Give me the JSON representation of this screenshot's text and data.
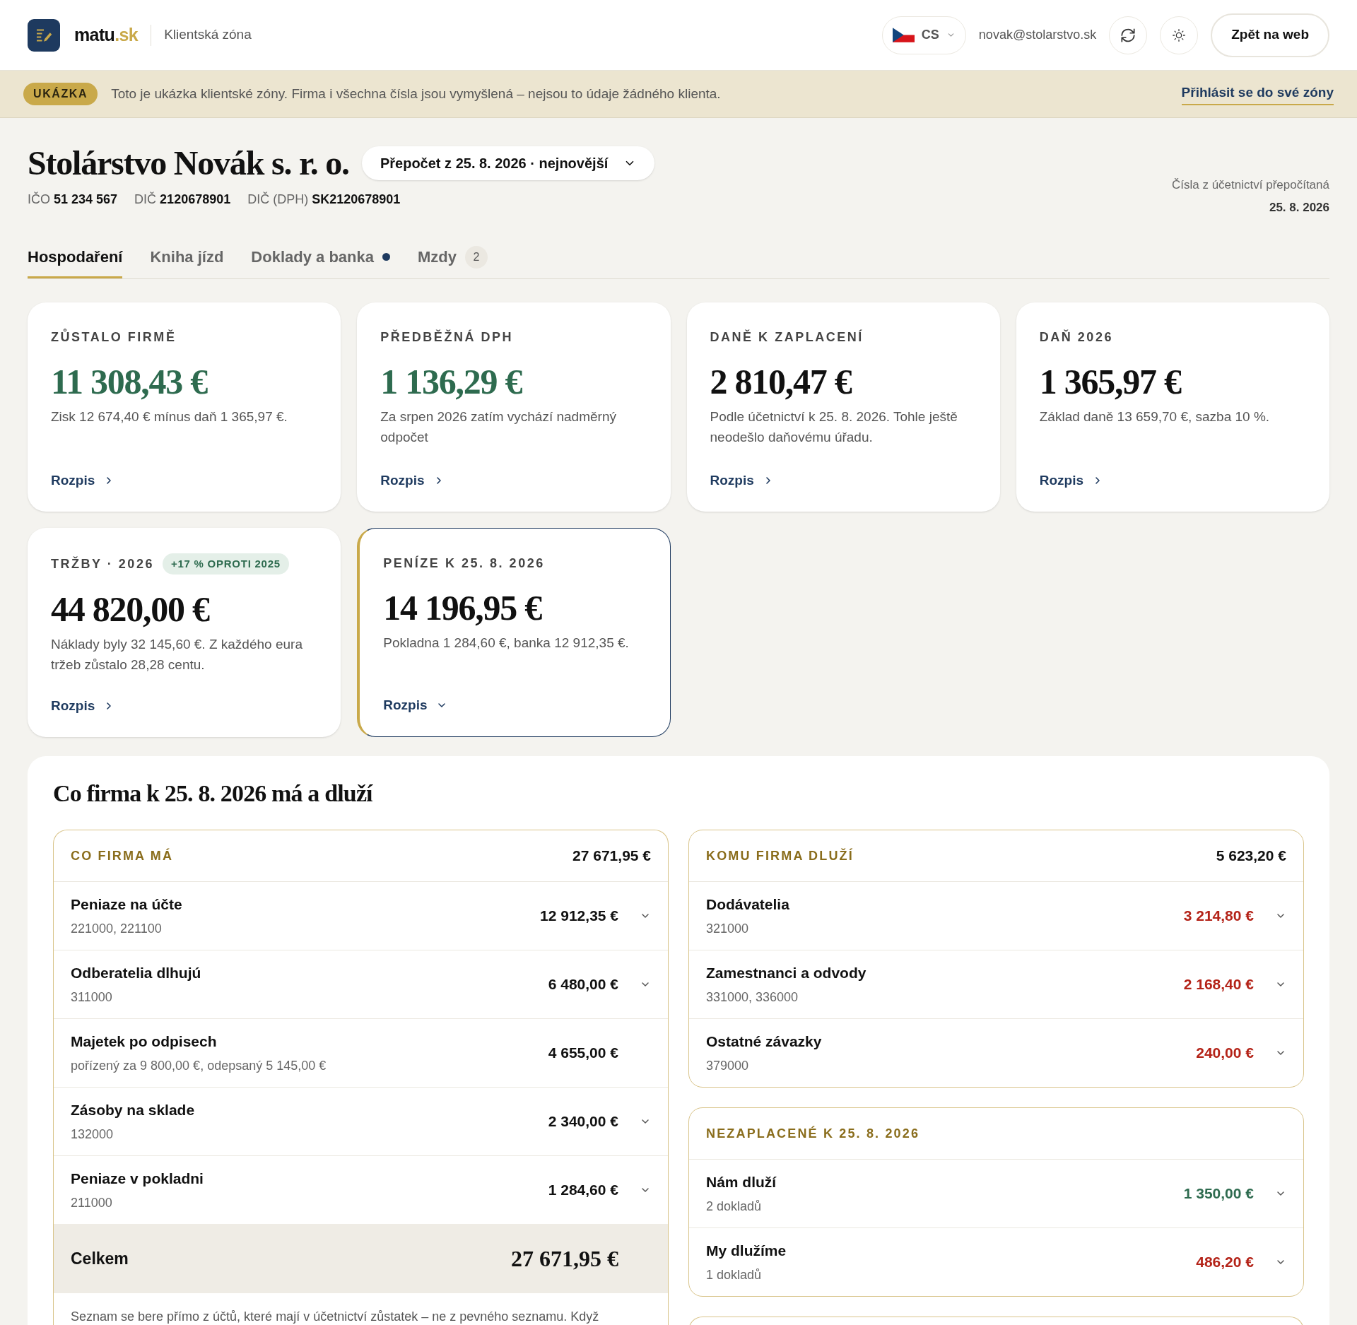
{
  "header": {
    "logo_text": "matu",
    "logo_domain": ".sk",
    "subtitle": "Klientská zóna",
    "language": "CS",
    "email": "novak@stolarstvo.sk",
    "back_button": "Zpět na web"
  },
  "banner": {
    "badge": "UKÁZKA",
    "text": "Toto je ukázka klientské zóny. Firma i všechna čísla jsou vymyšlená – nejsou to údaje žádného klienta.",
    "link": "Přihlásit se do své zóny"
  },
  "company": {
    "name": "Stolárstvo Novák s. r. o.",
    "period_select": "Přepočet z 25. 8. 2026 · nejnovější",
    "ids": [
      {
        "label": "IČO",
        "value": "51 234 567"
      },
      {
        "label": "DIČ",
        "value": "2120678901"
      },
      {
        "label": "DIČ (DPH)",
        "value": "SK2120678901"
      }
    ],
    "recalc_note": "Čísla z účetnictví přepočítaná",
    "recalc_date": "25. 8. 2026"
  },
  "tabs": [
    {
      "label": "Hospodaření",
      "selected": true,
      "dot": false
    },
    {
      "label": "Kniha jízd",
      "selected": false,
      "dot": false
    },
    {
      "label": "Doklady a banka",
      "selected": false,
      "dot": true
    },
    {
      "label": "Mzdy",
      "selected": false,
      "dot": false,
      "count": "2"
    }
  ],
  "cards": [
    {
      "title": "ZŮSTALO FIRMĚ",
      "value": "11 308,43 €",
      "color": "#2e6b4f",
      "note": "Zisk 12 674,40 € mínus daň 1 365,97 €.",
      "link": "Rozpis",
      "expanded": false
    },
    {
      "title": "PŘEDBĚŽNÁ DPH",
      "value": "1 136,29 €",
      "color": "#2e6b4f",
      "note": "Za srpen 2026 zatím vychází nadměrný odpočet",
      "link": "Rozpis",
      "expanded": false
    },
    {
      "title": "DANĚ K ZAPLACENÍ",
      "value": "2 810,47 €",
      "color": "#111111",
      "note": "Podle účetnictví k 25. 8. 2026. Tohle ještě neodešlo daňovému úřadu.",
      "link": "Rozpis",
      "expanded": false
    },
    {
      "title": "DAŇ 2026",
      "value": "1 365,97 €",
      "color": "#111111",
      "note": "Základ daně 13 659,70 €, sazba 10 %.",
      "link": "Rozpis",
      "expanded": false
    },
    {
      "title": "TRŽBY · 2026",
      "badge": "+17 % OPROTI 2025",
      "value": "44 820,00 €",
      "color": "#111111",
      "note": "Náklady byly 32 145,60 €. Z každého eura tržeb zůstalo 28,28 centu.",
      "link": "Rozpis",
      "expanded": false
    },
    {
      "title": "PENÍZE K 25. 8. 2026",
      "value": "14 196,95 €",
      "color": "#111111",
      "note": "Pokladna 1 284,60 €, banka 12 912,35 €.",
      "link": "Rozpis",
      "expanded": true
    }
  ],
  "balance": {
    "title": "Co firma k 25. 8. 2026 má a dluží",
    "assets": {
      "heading": "CO FIRMA MÁ",
      "total": "27 671,95 €",
      "rows": [
        {
          "name": "Peniaze na účte",
          "detail": "221000, 221100",
          "amount": "12 912,35 €",
          "color": "#111111",
          "expandable": true
        },
        {
          "name": "Odberatelia dlhujú",
          "detail": "311000",
          "amount": "6 480,00 €",
          "color": "#111111",
          "expandable": true
        },
        {
          "name": "Majetek po odpisech",
          "detail": "pořízený za 9 800,00 €, odepsaný 5 145,00 €",
          "amount": "4 655,00 €",
          "color": "#111111",
          "expandable": false
        },
        {
          "name": "Zásoby na sklade",
          "detail": "132000",
          "amount": "2 340,00 €",
          "color": "#111111",
          "expandable": true
        },
        {
          "name": "Peniaze v pokladni",
          "detail": "211000",
          "amount": "1 284,60 €",
          "color": "#111111",
          "expandable": true
        }
      ],
      "sum_label": "Celkem",
      "sum_value": "27 671,95 €",
      "footnote": "Seznam se bere přímo z účtů, které mají v účetnictví zůstatek – ne z pevného seznamu. Když"
    },
    "liabilities": {
      "heading": "KOMU FIRMA DLUŽÍ",
      "total": "5 623,20 €",
      "rows": [
        {
          "name": "Dodávatelia",
          "detail": "321000",
          "amount": "3 214,80 €",
          "color": "#b42318",
          "expandable": true
        },
        {
          "name": "Zamestnanci a odvody",
          "detail": "331000, 336000",
          "amount": "2 168,40 €",
          "color": "#b42318",
          "expandable": true
        },
        {
          "name": "Ostatné závazky",
          "detail": "379000",
          "amount": "240,00 €",
          "color": "#b42318",
          "expandable": true
        }
      ]
    },
    "unpaid": {
      "heading": "NEZAPLACENÉ K 25. 8. 2026",
      "rows": [
        {
          "name": "Nám dluží",
          "detail": "2 dokladů",
          "amount": "1 350,00 €",
          "color": "#2e6b4f",
          "expandable": true
        },
        {
          "name": "My dlužíme",
          "detail": "1 dokladů",
          "amount": "486,20 €",
          "color": "#b42318",
          "expandable": true
        }
      ]
    }
  }
}
